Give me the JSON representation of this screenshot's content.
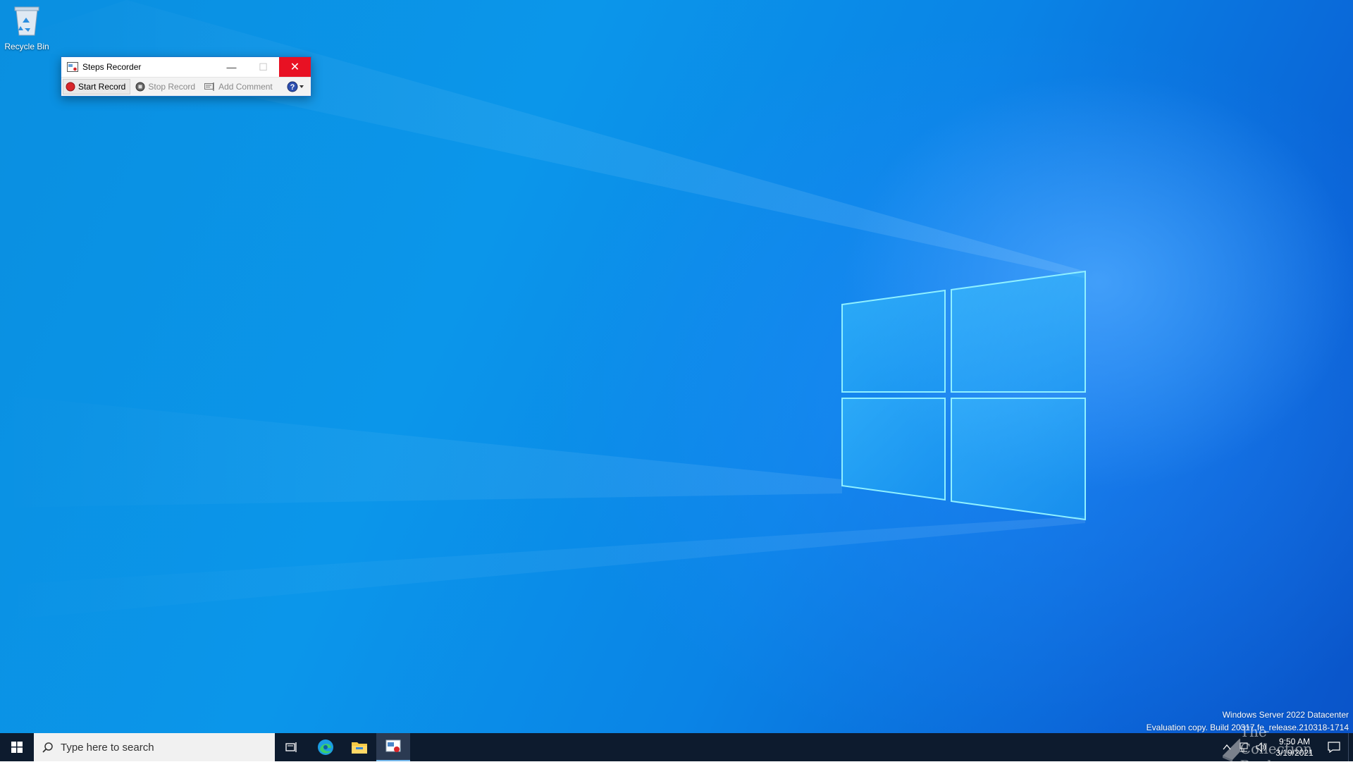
{
  "desktop": {
    "icons": [
      {
        "label": "Recycle Bin",
        "icon": "recycle-bin-icon"
      }
    ],
    "watermark": {
      "line1": "Windows Server 2022 Datacenter",
      "line2": "Evaluation copy. Build 20317.fe_release.210318-1714"
    }
  },
  "recorder": {
    "title": "Steps Recorder",
    "toolbar": {
      "start_label": "Start Record",
      "stop_label": "Stop Record",
      "comment_label": "Add Comment"
    }
  },
  "taskbar": {
    "search_placeholder": "Type here to search",
    "pinned": [
      "task-view-icon",
      "edge-icon",
      "file-explorer-icon",
      "steps-recorder-icon"
    ],
    "clock": {
      "time": "9:50 AM",
      "date": "3/19/2021"
    },
    "brand": "The Collection Book"
  },
  "colors": {
    "close_red": "#e81123",
    "taskbar_bg": "#0d1b2e",
    "desktop_blue": "#0a8fe0"
  }
}
